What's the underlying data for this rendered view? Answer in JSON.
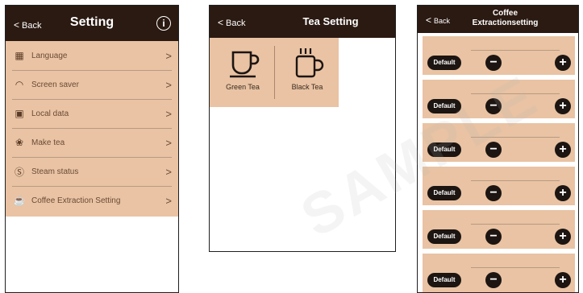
{
  "setting_screen": {
    "back_label": "Back",
    "title": "Setting",
    "info_label": "i",
    "items": [
      {
        "label": "Language"
      },
      {
        "label": "Screen saver"
      },
      {
        "label": "Local data"
      },
      {
        "label": "Make tea"
      },
      {
        "label": "Steam status"
      },
      {
        "label": "Coffee Extraction Setting"
      }
    ]
  },
  "tea_screen": {
    "back_label": "Back",
    "title": "Tea Setting",
    "options": [
      {
        "label": "Green Tea",
        "icon": "cup-icon"
      },
      {
        "label": "Black Tea",
        "icon": "steaming-mug-icon"
      }
    ]
  },
  "extraction_screen": {
    "back_label": "Back",
    "title_line1": "Coffee",
    "title_line2": "Extractionsetting",
    "default_label": "Default",
    "minus_label": "−",
    "plus_label": "+",
    "slots": [
      {},
      {},
      {},
      {},
      {},
      {}
    ]
  },
  "watermark": "SAMPLE"
}
